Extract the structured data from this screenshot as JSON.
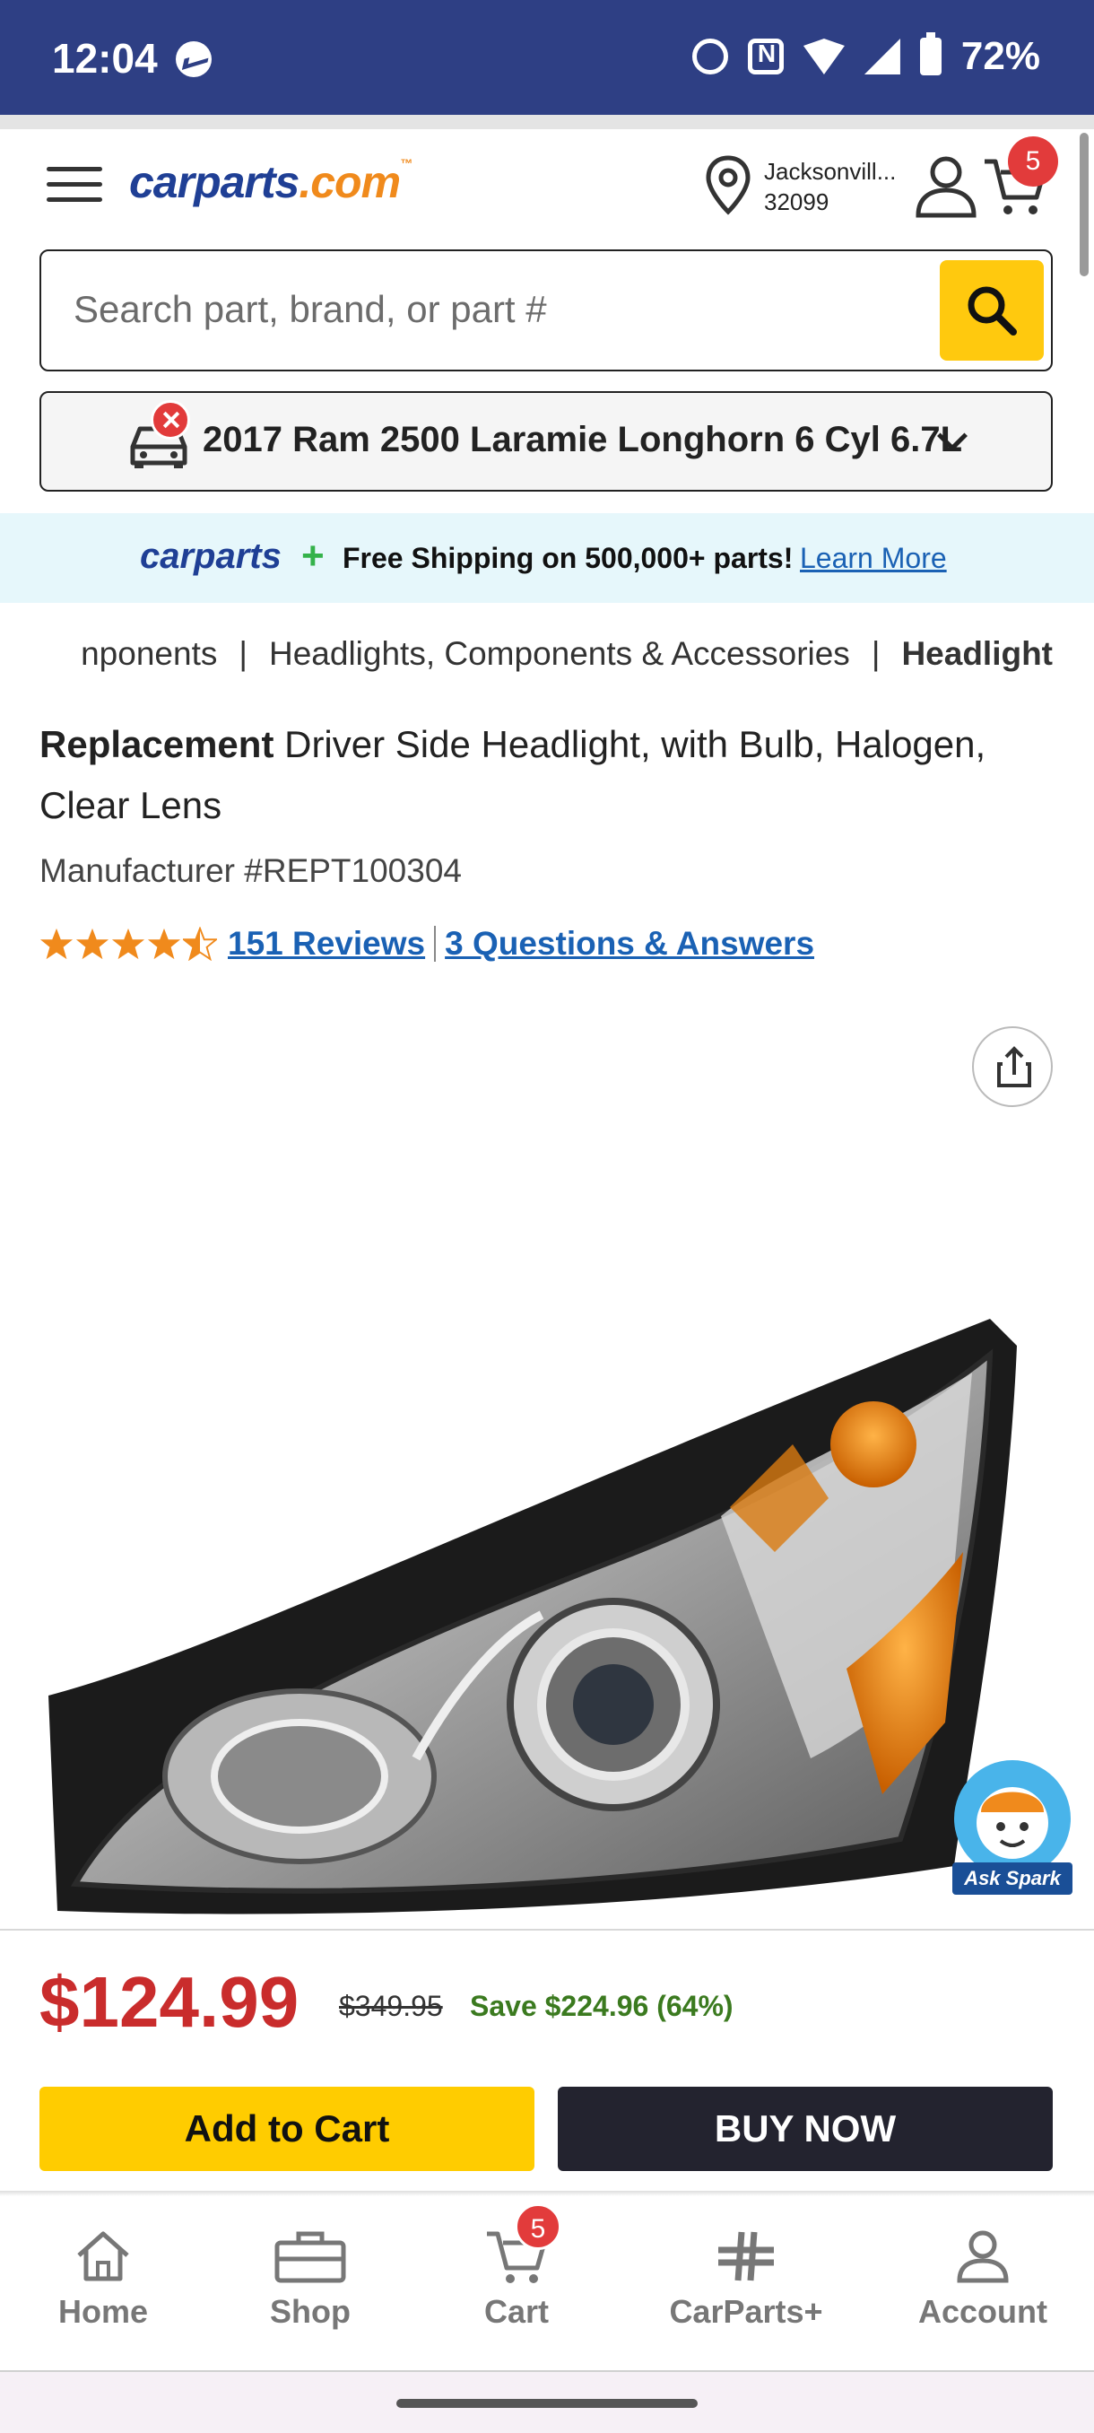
{
  "status_bar": {
    "time": "12:04",
    "battery": "72%",
    "icons": [
      "messenger-icon",
      "alarm-icon",
      "nfc-icon",
      "wifi-icon",
      "signal-icon",
      "battery-icon"
    ]
  },
  "header": {
    "logo_main": "carparts",
    "logo_suffix": ".com",
    "logo_tm": "™",
    "location_city": "Jacksonvill...",
    "location_zip": "32099",
    "cart_count": "5"
  },
  "search": {
    "placeholder": "Search part, brand, or part #"
  },
  "vehicle": {
    "label": "2017 Ram 2500 Laramie Longhorn 6 Cyl 6.7L"
  },
  "promo": {
    "logo": "carparts",
    "plus": "+",
    "text": "Free Shipping on 500,000+ parts!",
    "link": "Learn More"
  },
  "breadcrumb": {
    "items": [
      "Components",
      "Headlights, Components & Accessories"
    ],
    "visible_first": "nponents",
    "current": "Headlight"
  },
  "product": {
    "brand": "Replacement",
    "title": " Driver Side Headlight, with Bulb, Halogen, Clear Lens",
    "manufacturer": "Manufacturer #REPT100304",
    "rating": 4.5,
    "reviews_link": "151 Reviews",
    "qa_link": "3 Questions & Answers",
    "price": "$124.99",
    "old_price": "$349.95",
    "save": "Save $224.96 (64%)"
  },
  "assistant": {
    "label": "Ask Spark"
  },
  "actions": {
    "add_to_cart": "Add to Cart",
    "buy_now": "BUY NOW"
  },
  "bottom_nav": {
    "home": "Home",
    "shop": "Shop",
    "cart": "Cart",
    "cart_badge": "5",
    "carparts_plus": "CarParts+",
    "account": "Account"
  },
  "colors": {
    "status_bar": "#2e3f84",
    "brand_blue": "#1f3f95",
    "accent_yellow": "#ffcc00",
    "price_red": "#c92c2c",
    "save_green": "#3b7a1f",
    "link_blue": "#1a61b4"
  }
}
